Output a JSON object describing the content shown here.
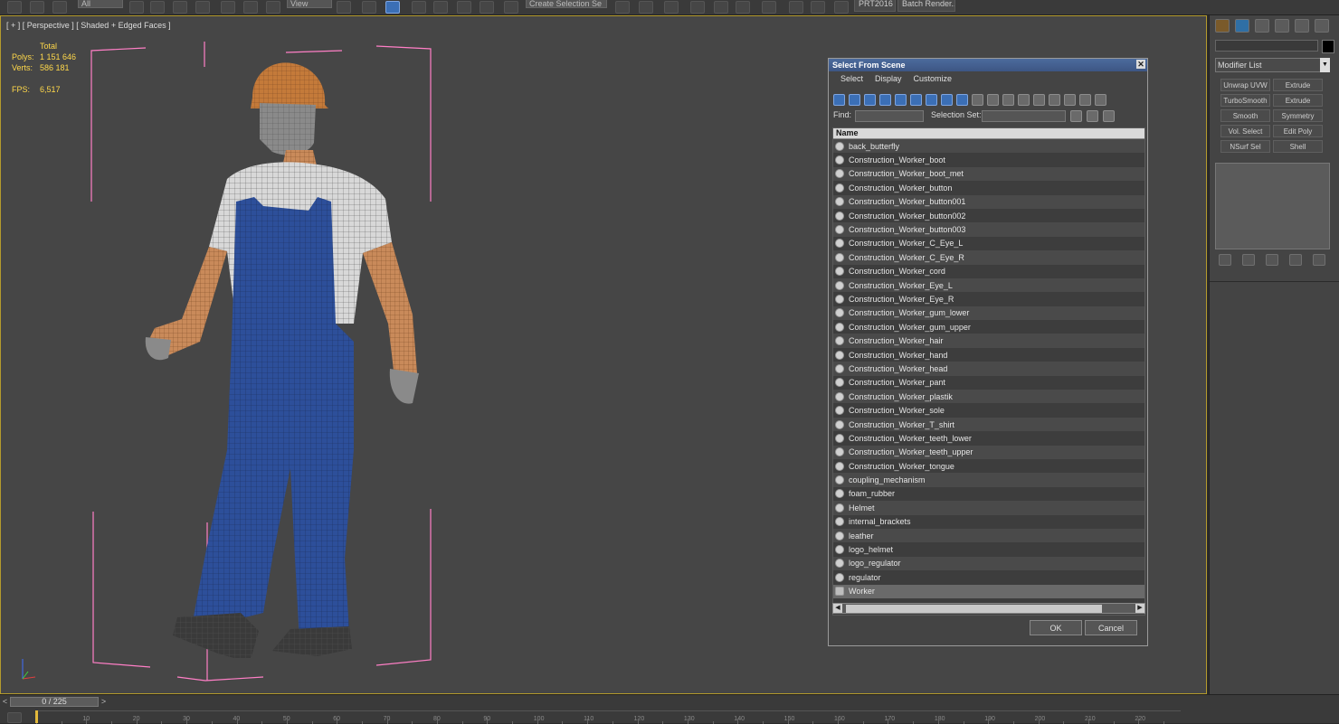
{
  "toolbar": {
    "dropdown_all": "All",
    "dropdown_view": "View",
    "dropdown_selection_set": "Create Selection Se",
    "prt_label": "PRT2016",
    "batch_render_label": "Batch Render..."
  },
  "viewport": {
    "label": "[ + ] [ Perspective ] [ Shaded + Edged Faces ]",
    "stats": {
      "total_label": "Total",
      "polys_label": "Polys:",
      "polys_value": "1 151 646",
      "verts_label": "Verts:",
      "verts_value": "586 181",
      "fps_label": "FPS:",
      "fps_value": "6,517"
    }
  },
  "dialog": {
    "title": "Select From Scene",
    "close": "✕",
    "menu": [
      "Select",
      "Display",
      "Customize"
    ],
    "find_label": "Find:",
    "selection_set_label": "Selection Set:",
    "column_header": "Name",
    "items": [
      "back_butterfly",
      "Construction_Worker_boot",
      "Construction_Worker_boot_met",
      "Construction_Worker_button",
      "Construction_Worker_button001",
      "Construction_Worker_button002",
      "Construction_Worker_button003",
      "Construction_Worker_C_Eye_L",
      "Construction_Worker_C_Eye_R",
      "Construction_Worker_cord",
      "Construction_Worker_Eye_L",
      "Construction_Worker_Eye_R",
      "Construction_Worker_gum_lower",
      "Construction_Worker_gum_upper",
      "Construction_Worker_hair",
      "Construction_Worker_hand",
      "Construction_Worker_head",
      "Construction_Worker_pant",
      "Construction_Worker_plastik",
      "Construction_Worker_sole",
      "Construction_Worker_T_shirt",
      "Construction_Worker_teeth_lower",
      "Construction_Worker_teeth_upper",
      "Construction_Worker_tongue",
      "coupling_mechanism",
      "foam_rubber",
      "Helmet",
      "internal_brackets",
      "leather",
      "logo_helmet",
      "logo_regulator",
      "regulator",
      "Worker"
    ],
    "selected_index": 32,
    "ok_label": "OK",
    "cancel_label": "Cancel"
  },
  "command_panel": {
    "modifier_list": "Modifier List",
    "modifiers": [
      "Unwrap UVW",
      "Extrude",
      "TurboSmooth",
      "Extrude",
      "Smooth",
      "Symmetry",
      "Vol. Select",
      "Edit Poly",
      "NSurf Sel",
      "Shell"
    ]
  },
  "timeline": {
    "frame_display": "0 / 225",
    "ticks": [
      "10",
      "20",
      "30",
      "40",
      "50",
      "60",
      "70",
      "80",
      "90",
      "100",
      "110",
      "120",
      "130",
      "140",
      "150",
      "160",
      "170",
      "180",
      "190",
      "200",
      "210",
      "220"
    ]
  },
  "colors": {
    "viewport_bg": "#464646",
    "active_border": "#b49b2d",
    "stats_text": "#ffd84a",
    "bbox": "#ff7fc6",
    "overalls": "#2d4f9a",
    "skin": "#c98a5a"
  }
}
